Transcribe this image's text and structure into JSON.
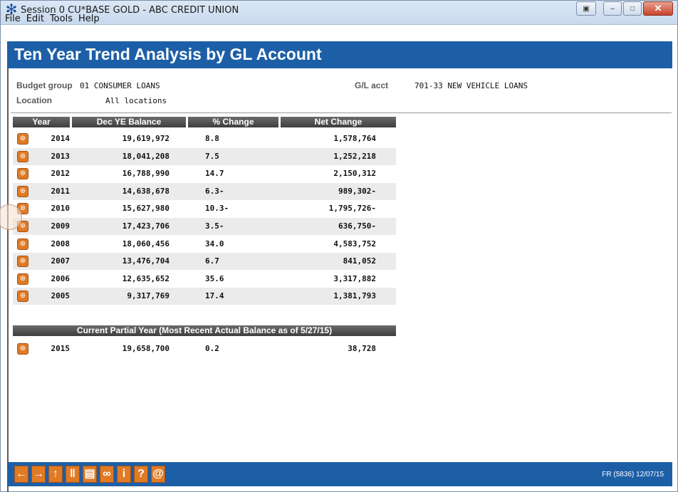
{
  "window": {
    "title": "Session 0 CU*BASE GOLD - ABC CREDIT UNION"
  },
  "menu": [
    "File",
    "Edit",
    "Tools",
    "Help"
  ],
  "page": {
    "title": "Ten Year Trend Analysis by GL Account"
  },
  "info": {
    "budget_group_label": "Budget group",
    "budget_group_value": "01 CONSUMER LOANS",
    "location_label": "Location",
    "location_value": "All locations",
    "gl_acct_label": "G/L acct",
    "gl_acct_value": "701-33 NEW VEHICLE LOANS"
  },
  "table": {
    "columns": [
      "Year",
      "Dec YE Balance",
      "% Change",
      "Net Change"
    ],
    "rows": [
      {
        "year": "2014",
        "balance": "19,619,972",
        "pct": "8.8",
        "net": "1,578,764"
      },
      {
        "year": "2013",
        "balance": "18,041,208",
        "pct": "7.5",
        "net": "1,252,218"
      },
      {
        "year": "2012",
        "balance": "16,788,990",
        "pct": "14.7",
        "net": "2,150,312"
      },
      {
        "year": "2011",
        "balance": "14,638,678",
        "pct": "6.3-",
        "net": "989,302-"
      },
      {
        "year": "2010",
        "balance": "15,627,980",
        "pct": "10.3-",
        "net": "1,795,726-"
      },
      {
        "year": "2009",
        "balance": "17,423,706",
        "pct": "3.5-",
        "net": "636,750-"
      },
      {
        "year": "2008",
        "balance": "18,060,456",
        "pct": "34.0",
        "net": "4,583,752"
      },
      {
        "year": "2007",
        "balance": "13,476,704",
        "pct": "6.7",
        "net": "841,052"
      },
      {
        "year": "2006",
        "balance": "12,635,652",
        "pct": "35.6",
        "net": "3,317,882"
      },
      {
        "year": "2005",
        "balance": "9,317,769",
        "pct": "17.4",
        "net": "1,381,793"
      }
    ]
  },
  "partial": {
    "header": "Current Partial Year (Most Recent Actual Balance as of 5/27/15)",
    "row": {
      "year": "2015",
      "balance": "19,658,700",
      "pct": "0.2",
      "net": "38,728"
    }
  },
  "toolbar": {
    "buttons": [
      {
        "name": "back-arrow-icon",
        "glyph": "←"
      },
      {
        "name": "forward-arrow-icon",
        "glyph": "→"
      },
      {
        "name": "up-arrow-icon",
        "glyph": "↑"
      },
      {
        "name": "pause-icon",
        "glyph": "‖"
      },
      {
        "name": "print-icon",
        "glyph": "▤"
      },
      {
        "name": "link-icon",
        "glyph": "∞"
      },
      {
        "name": "info-icon",
        "glyph": "i"
      },
      {
        "name": "help-icon",
        "glyph": "?"
      },
      {
        "name": "at-icon",
        "glyph": "@"
      }
    ],
    "screen_code": "FR (5836) 12/07/15"
  },
  "colors": {
    "banner_blue": "#1d5fa7",
    "button_orange": "#e07a24",
    "header_gray": "#4a4a4a"
  }
}
